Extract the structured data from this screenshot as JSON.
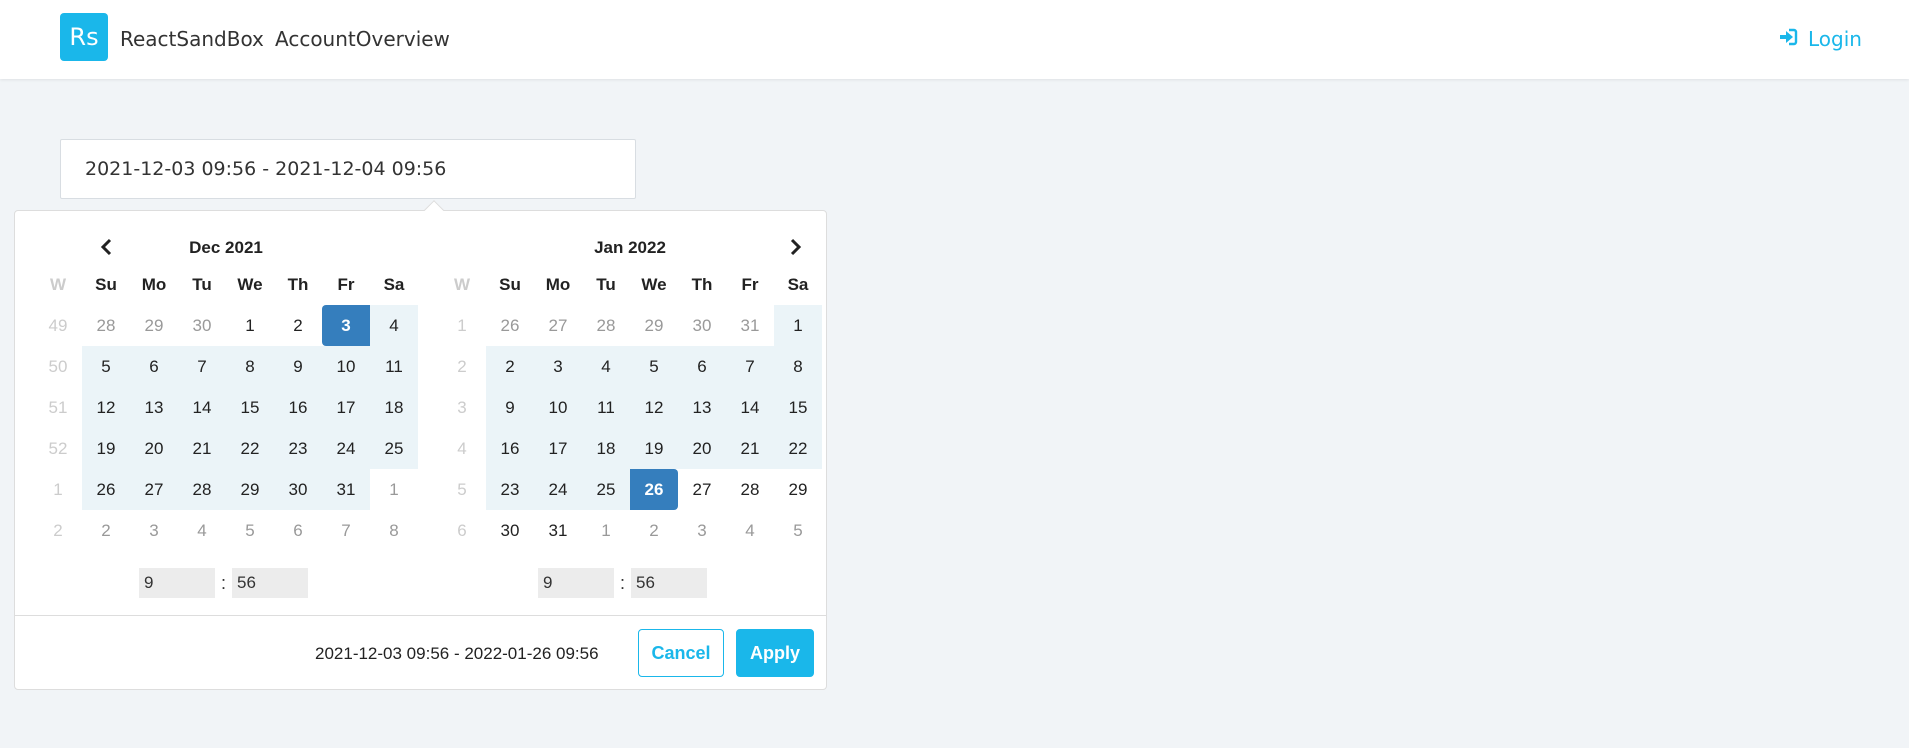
{
  "navbar": {
    "logo_text": "Rs",
    "brand": "ReactSandBox",
    "link": "AccountOverview",
    "login": "Login"
  },
  "input": {
    "value": "2021-12-03 09:56 - 2021-12-04 09:56"
  },
  "left_calendar": {
    "title": "Dec 2021",
    "headers": [
      "W",
      "Su",
      "Mo",
      "Tu",
      "We",
      "Th",
      "Fr",
      "Sa"
    ],
    "weeks": [
      {
        "wk": "49",
        "days": [
          {
            "d": "28",
            "s": "off"
          },
          {
            "d": "29",
            "s": "off"
          },
          {
            "d": "30",
            "s": "off"
          },
          {
            "d": "1",
            "s": "norm"
          },
          {
            "d": "2",
            "s": "norm"
          },
          {
            "d": "3",
            "s": "sel start"
          },
          {
            "d": "4",
            "s": "in"
          }
        ]
      },
      {
        "wk": "50",
        "days": [
          {
            "d": "5",
            "s": "in"
          },
          {
            "d": "6",
            "s": "in"
          },
          {
            "d": "7",
            "s": "in"
          },
          {
            "d": "8",
            "s": "in"
          },
          {
            "d": "9",
            "s": "in"
          },
          {
            "d": "10",
            "s": "in"
          },
          {
            "d": "11",
            "s": "in"
          }
        ]
      },
      {
        "wk": "51",
        "days": [
          {
            "d": "12",
            "s": "in"
          },
          {
            "d": "13",
            "s": "in"
          },
          {
            "d": "14",
            "s": "in"
          },
          {
            "d": "15",
            "s": "in"
          },
          {
            "d": "16",
            "s": "in"
          },
          {
            "d": "17",
            "s": "in"
          },
          {
            "d": "18",
            "s": "in"
          }
        ]
      },
      {
        "wk": "52",
        "days": [
          {
            "d": "19",
            "s": "in"
          },
          {
            "d": "20",
            "s": "in"
          },
          {
            "d": "21",
            "s": "in"
          },
          {
            "d": "22",
            "s": "in"
          },
          {
            "d": "23",
            "s": "in"
          },
          {
            "d": "24",
            "s": "in"
          },
          {
            "d": "25",
            "s": "in"
          }
        ]
      },
      {
        "wk": "1",
        "days": [
          {
            "d": "26",
            "s": "in"
          },
          {
            "d": "27",
            "s": "in"
          },
          {
            "d": "28",
            "s": "in"
          },
          {
            "d": "29",
            "s": "in"
          },
          {
            "d": "30",
            "s": "in"
          },
          {
            "d": "31",
            "s": "in"
          },
          {
            "d": "1",
            "s": "off"
          }
        ]
      },
      {
        "wk": "2",
        "days": [
          {
            "d": "2",
            "s": "off"
          },
          {
            "d": "3",
            "s": "off"
          },
          {
            "d": "4",
            "s": "off"
          },
          {
            "d": "5",
            "s": "off"
          },
          {
            "d": "6",
            "s": "off"
          },
          {
            "d": "7",
            "s": "off"
          },
          {
            "d": "8",
            "s": "off"
          }
        ]
      }
    ],
    "hour": "9",
    "minute": "56"
  },
  "right_calendar": {
    "title": "Jan 2022",
    "headers": [
      "W",
      "Su",
      "Mo",
      "Tu",
      "We",
      "Th",
      "Fr",
      "Sa"
    ],
    "weeks": [
      {
        "wk": "1",
        "days": [
          {
            "d": "26",
            "s": "off"
          },
          {
            "d": "27",
            "s": "off"
          },
          {
            "d": "28",
            "s": "off"
          },
          {
            "d": "29",
            "s": "off"
          },
          {
            "d": "30",
            "s": "off"
          },
          {
            "d": "31",
            "s": "off"
          },
          {
            "d": "1",
            "s": "in"
          }
        ]
      },
      {
        "wk": "2",
        "days": [
          {
            "d": "2",
            "s": "in"
          },
          {
            "d": "3",
            "s": "in"
          },
          {
            "d": "4",
            "s": "in"
          },
          {
            "d": "5",
            "s": "in"
          },
          {
            "d": "6",
            "s": "in"
          },
          {
            "d": "7",
            "s": "in"
          },
          {
            "d": "8",
            "s": "in"
          }
        ]
      },
      {
        "wk": "3",
        "days": [
          {
            "d": "9",
            "s": "in"
          },
          {
            "d": "10",
            "s": "in"
          },
          {
            "d": "11",
            "s": "in"
          },
          {
            "d": "12",
            "s": "in"
          },
          {
            "d": "13",
            "s": "in"
          },
          {
            "d": "14",
            "s": "in"
          },
          {
            "d": "15",
            "s": "in"
          }
        ]
      },
      {
        "wk": "4",
        "days": [
          {
            "d": "16",
            "s": "in"
          },
          {
            "d": "17",
            "s": "in"
          },
          {
            "d": "18",
            "s": "in"
          },
          {
            "d": "19",
            "s": "in"
          },
          {
            "d": "20",
            "s": "in"
          },
          {
            "d": "21",
            "s": "in"
          },
          {
            "d": "22",
            "s": "in"
          }
        ]
      },
      {
        "wk": "5",
        "days": [
          {
            "d": "23",
            "s": "in"
          },
          {
            "d": "24",
            "s": "in"
          },
          {
            "d": "25",
            "s": "in"
          },
          {
            "d": "26",
            "s": "sel end"
          },
          {
            "d": "27",
            "s": "norm"
          },
          {
            "d": "28",
            "s": "norm"
          },
          {
            "d": "29",
            "s": "norm"
          }
        ]
      },
      {
        "wk": "6",
        "days": [
          {
            "d": "30",
            "s": "norm"
          },
          {
            "d": "31",
            "s": "norm"
          },
          {
            "d": "1",
            "s": "off"
          },
          {
            "d": "2",
            "s": "off"
          },
          {
            "d": "3",
            "s": "off"
          },
          {
            "d": "4",
            "s": "off"
          },
          {
            "d": "5",
            "s": "off"
          }
        ]
      }
    ],
    "hour": "9",
    "minute": "56"
  },
  "footer": {
    "range": "2021-12-03 09:56 - 2022-01-26 09:56",
    "cancel": "Cancel",
    "apply": "Apply"
  },
  "colors": {
    "accent": "#1ab7ea",
    "selected": "#357ebd",
    "in_range": "#ebf4f8"
  },
  "icons": {
    "login": "sign-in-icon",
    "prev": "chevron-left-icon",
    "next": "chevron-right-icon"
  }
}
